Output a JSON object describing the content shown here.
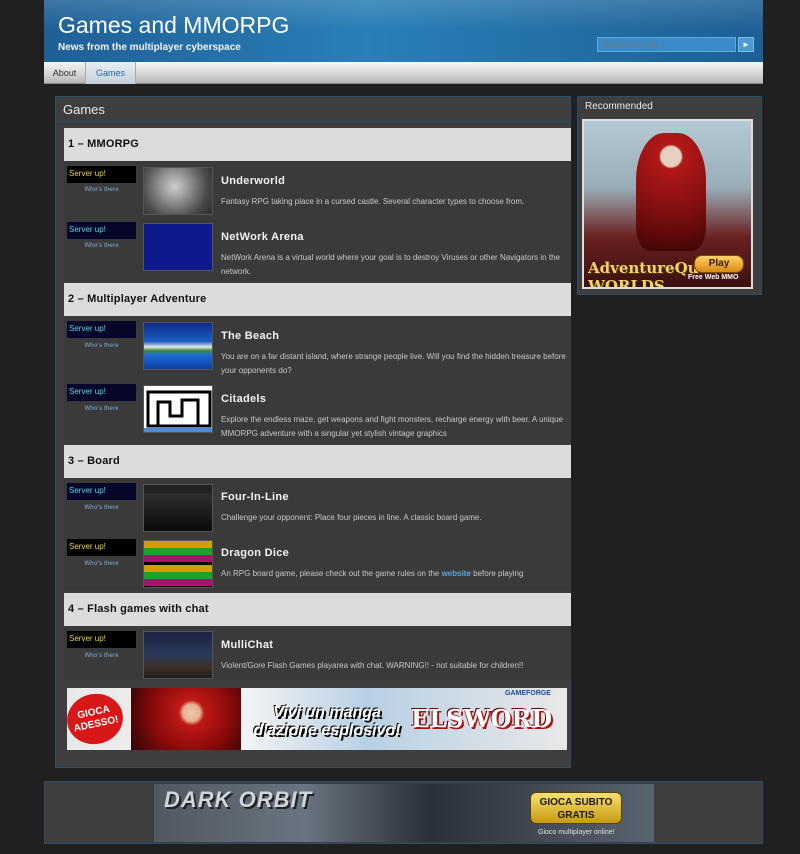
{
  "header": {
    "title": "Games and MMORPG",
    "tagline": "News from the multiplayer cyberspace",
    "search_placeholder": "Search this site...",
    "search_button": "►"
  },
  "nav": {
    "items": [
      {
        "label": "About"
      },
      {
        "label": "Games"
      }
    ]
  },
  "main": {
    "title": "Games",
    "categories": [
      {
        "label": "1 – MMORPG",
        "games": [
          {
            "status": "Server up!",
            "whos_there": "Who's there",
            "title": "Underworld",
            "description": "Fantasy RPG taking place in a cursed castle. Several character types to choose from."
          },
          {
            "status": "Server up!",
            "whos_there": "Who's there",
            "title": "NetWork Arena",
            "description": "NetWork Arena is a virtual world where your goal is to destroy Viruses or other Navigators in the network."
          }
        ]
      },
      {
        "label": "2 – Multiplayer Adventure",
        "games": [
          {
            "status": "Server up!",
            "whos_there": "Who's there",
            "title": "The Beach",
            "description": "You are on a far distant island, where strange people live. Will you find the hidden treasure before your opponents do?"
          },
          {
            "status": "Server up!",
            "whos_there": "Who's there",
            "title": "Citadels",
            "description": "Explore the endless maze, get weapons and fight monsters, recharge energy with beer. A unique MMORPG adventure with a singular yet stylish vintage graphics"
          }
        ]
      },
      {
        "label": "3 – Board",
        "games": [
          {
            "status": "Server up!",
            "whos_there": "Who's there",
            "title": "Four-In-Line",
            "description": "Challenge your opponent: Place four pieces in line. A classic board game."
          },
          {
            "status": "Server up!",
            "whos_there": "Who's there",
            "title": "Dragon Dice",
            "description_before": "An RPG board game, please check out the game rules on the ",
            "description_link": "website",
            "description_after": " before playing"
          }
        ]
      },
      {
        "label": "4 – Flash games with chat",
        "games": [
          {
            "status": "Server up!",
            "whos_there": "Who's there",
            "title": "MulliChat",
            "description": "Violent/Gore Flash Games playarea with chat. WARNING!! - not suitable for children!!"
          }
        ]
      }
    ]
  },
  "sidebar": {
    "title": "Recommended",
    "ad": {
      "logo": "AdventureQuest WORLDS",
      "play": "Play",
      "sub": "Free Web MMO"
    }
  },
  "banner_elsword": {
    "badge": "GIOCA ADESSO!",
    "headline_line1": "Vivi un manga",
    "headline_line2": "d'azione esplosivo!",
    "logo": "ELSWORD",
    "brand": "GAMEFORGE"
  },
  "footer_banner": {
    "logo": "DARK ORBIT",
    "cta": "GIOCA SUBITO GRATIS",
    "sub": "Gioco multiplayer online!"
  },
  "colors": {
    "header_blue": "#2a7fb8",
    "link_blue": "#5aa8e0",
    "status_yellow": "#e8d84a",
    "status_cyan": "#5ad8e0"
  }
}
